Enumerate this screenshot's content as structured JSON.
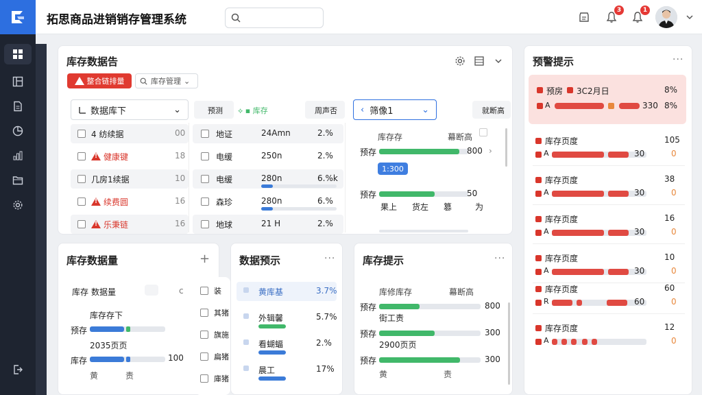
{
  "app": {
    "title": "拓思商品进销销存管理系统"
  },
  "topbar": {
    "notifications_badge_1": "3",
    "notifications_badge_2": "1"
  },
  "sidebar": {
    "items": [
      "dashboard",
      "layout",
      "document",
      "chart-pie",
      "chart-bar",
      "folder",
      "settings"
    ]
  },
  "main": {
    "title": "库存数据告",
    "alert_button": "整合链排量",
    "dropdown_label": "库存管理",
    "filter1": "数据库下",
    "col_a": "预测",
    "col_b": "库存",
    "col_c": "周声否",
    "filter2": "筛像1",
    "col_d": "就断高",
    "rows": [
      {
        "name": "4 纺续据",
        "num": "00",
        "warn": false,
        "label": "地证",
        "value": "24Amn",
        "pct": "2.%"
      },
      {
        "name": "健康键",
        "num": "18",
        "warn": true,
        "label": "电缓",
        "value": "250n",
        "pct": "2.%"
      },
      {
        "name": "几房1续据",
        "num": "10",
        "warn": false,
        "label": "电缓",
        "value": "280n",
        "pct": "6.%k",
        "bar": 0.15
      },
      {
        "name": "续费圆",
        "num": "16",
        "warn": true,
        "label": "森珍",
        "value": "280n",
        "pct": "6.%",
        "bar": 0.15
      },
      {
        "name": "乐秉链",
        "num": "16",
        "warn": true,
        "label": "地球",
        "value": "21 H",
        "pct": "2.%"
      }
    ],
    "chart_header_a": "库存存",
    "chart_header_b": "幕断高",
    "chart_rows": [
      {
        "label": "预存",
        "value": "800",
        "fill": 0.9
      },
      {
        "label": "预存",
        "value": "50",
        "fill": 0.62
      }
    ],
    "tooltip": "1:300",
    "axis_labels": [
      "果上",
      "货左",
      "篡",
      "为"
    ]
  },
  "card2": {
    "title": "库存数据量",
    "header_a": "库存",
    "header_b": "数据量",
    "items": [
      {
        "title": "库存存下",
        "label": "预存",
        "fill": 0.45,
        "value": ""
      },
      {
        "title": "2035页页",
        "label": "库存",
        "fill": 0.45,
        "value": "100"
      }
    ],
    "footer": [
      "黄",
      "责"
    ]
  },
  "card2b": {
    "rows": [
      "装",
      "其猪",
      "旗施",
      "扁猪",
      "庫猪"
    ]
  },
  "card3": {
    "title": "数据预示",
    "rows": [
      {
        "name": "黄库基",
        "pct": "3.7%",
        "fill": 0,
        "color": "#3b7bd8"
      },
      {
        "name": "外辑馨",
        "pct": "5.7%",
        "fill": 0.4,
        "color": "#41b86a"
      },
      {
        "name": "看蝴蝠",
        "pct": "2.%",
        "fill": 0.4,
        "color": "#3b7bd8"
      },
      {
        "name": "晨工",
        "pct": "17%",
        "fill": 0.4,
        "color": "#3b7bd8"
      }
    ]
  },
  "card4": {
    "title": "库存提示",
    "header_a": "库修库存",
    "header_b": "幕断高",
    "rows": [
      {
        "label": "预存",
        "sub": "街工责",
        "value": "800",
        "fill": 0.4
      },
      {
        "label": "预存",
        "sub": "2900页页",
        "value": "300",
        "fill": 0.55
      },
      {
        "label": "预存",
        "sub": "",
        "value": "300",
        "fill": 0.8
      }
    ],
    "footer": [
      "黄",
      "责"
    ]
  },
  "alerts": {
    "title": "预警提示",
    "highlight": {
      "label": "预房",
      "date": "3C2月日",
      "pct_a": "8%",
      "pct_b": "8%",
      "mid": "330",
      "prefix": "A"
    },
    "items": [
      {
        "label": "库存页度",
        "prefix": "A",
        "mid": "30",
        "top": "105",
        "bottom": "0"
      },
      {
        "label": "库存页度",
        "prefix": "A",
        "mid": "30",
        "top": "38",
        "bottom": "0"
      },
      {
        "label": "库存页度",
        "prefix": "A",
        "mid": "30",
        "top": "16",
        "bottom": "0"
      },
      {
        "label": "库存页度",
        "prefix": "A",
        "mid": "30",
        "top": "10",
        "bottom": "0"
      },
      {
        "label": "库存页度",
        "prefix": "R",
        "mid": "60",
        "top": "60",
        "bottom": "0"
      },
      {
        "label": "库存页度",
        "prefix": "A",
        "mid": "",
        "top": "12",
        "bottom": "0"
      }
    ]
  },
  "colors": {
    "primary": "#2d6fe0",
    "danger": "#d9362b",
    "success": "#41b86a",
    "sidebar": "#1e2430"
  }
}
